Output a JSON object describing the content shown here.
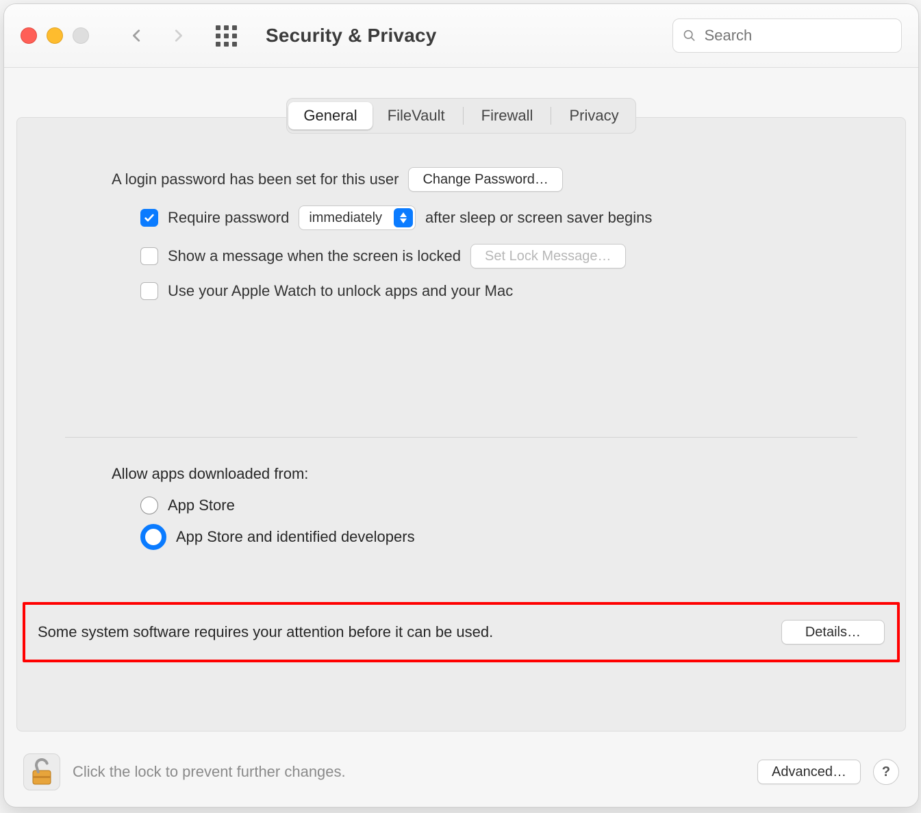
{
  "window": {
    "title": "Security & Privacy"
  },
  "search": {
    "placeholder": "Search"
  },
  "tabs": {
    "general": "General",
    "filevault": "FileVault",
    "firewall": "Firewall",
    "privacy": "Privacy"
  },
  "general": {
    "login_password_msg": "A login password has been set for this user",
    "change_password_btn": "Change Password…",
    "require_password_label": "Require password",
    "require_password_delay": "immediately",
    "require_password_suffix": "after sleep or screen saver begins",
    "show_message_label": "Show a message when the screen is locked",
    "set_lock_message_btn": "Set Lock Message…",
    "apple_watch_label": "Use your Apple Watch to unlock apps and your Mac",
    "allow_apps_title": "Allow apps downloaded from:",
    "allow_apps_opt1": "App Store",
    "allow_apps_opt2": "App Store and identified developers",
    "attention_msg": "Some system software requires your attention before it can be used.",
    "details_btn": "Details…"
  },
  "footer": {
    "lock_text": "Click the lock to prevent further changes.",
    "advanced_btn": "Advanced…",
    "help": "?"
  }
}
